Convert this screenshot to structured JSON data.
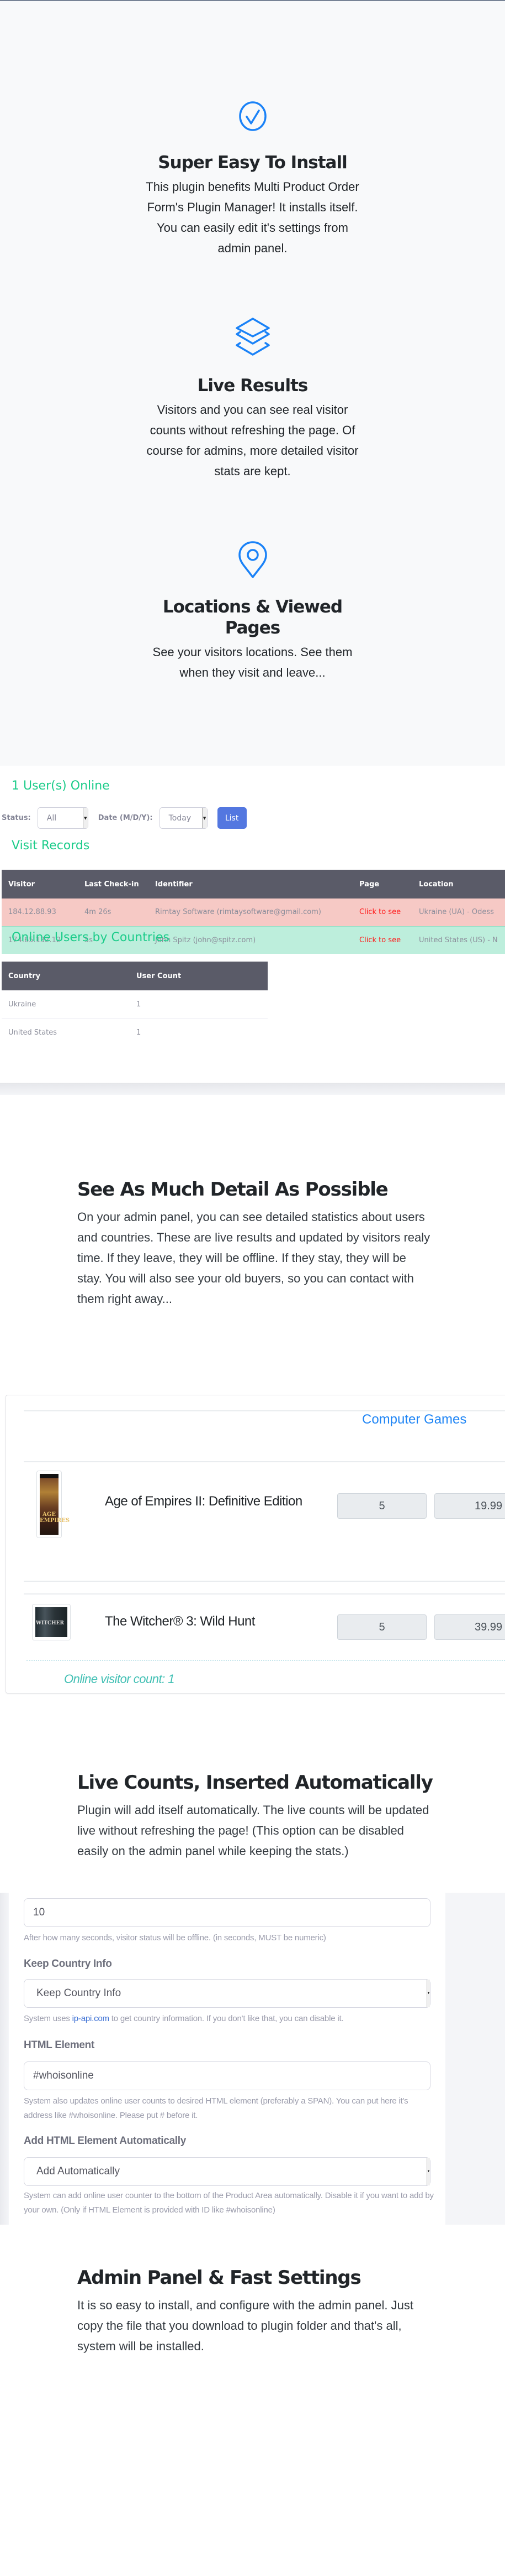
{
  "features": [
    {
      "icon": "check-circle-icon",
      "title": "Super Easy To Install",
      "text": "This plugin benefits Multi Product Order Form's Plugin Manager! It installs itself. You can easily edit it's settings from admin panel."
    },
    {
      "icon": "layers-icon",
      "title": "Live Results",
      "text": "Visitors and you can see real visitor counts without refreshing the page. Of course for admins, more detailed visitor stats are kept."
    },
    {
      "icon": "map-pin-icon",
      "title": "Locations & Viewed Pages",
      "text": "See your visitors locations. See them when they visit and leave..."
    }
  ],
  "visitors_panel": {
    "online_title": "1 User(s) Online",
    "status_label": "Status:",
    "status_value": "All",
    "date_label": "Date (M/D/Y):",
    "date_value": "Today",
    "list_button": "List",
    "records_title": "Visit Records",
    "columns": [
      "Visitor",
      "Last Check-in",
      "Identifier",
      "Page",
      "Location"
    ],
    "rows": [
      {
        "status": "offline",
        "visitor": "184.12.88.93",
        "last_checkin": "4m 26s",
        "identifier": "Rimtay Software (rimtaysoftware@gmail.com)",
        "page": "Click to see",
        "location": "Ukraine (UA) - Odess"
      },
      {
        "status": "online",
        "visitor": "174.65.132.12",
        "last_checkin": "5s",
        "identifier": "John Spitz (john@spitz.com)",
        "page": "Click to see",
        "location": "United States (US) - N"
      }
    ],
    "countries_title": "Online Users by Countries",
    "country_columns": [
      "Country",
      "User Count"
    ],
    "country_rows": [
      {
        "country": "Ukraine",
        "count": "1"
      },
      {
        "country": "United States",
        "count": "1"
      }
    ],
    "colors": {
      "accent_green": "#1ccc8a",
      "offline_row": "#f6c9c5",
      "online_row": "#bdeedc",
      "list_button": "#5377e0"
    }
  },
  "detail_block": {
    "title": "See As Much Detail As Possible",
    "text": "On your admin panel, you can see detailed statistics about users and countries. These are live results and updated by visitors realy time. If they leave, they will be offline. If they stay, they will be stay. You will also see your old buyers, so you can contact with them right away..."
  },
  "product_form": {
    "category": "Computer Games",
    "products": [
      {
        "name": "Age of Empires II: Definitive Edition",
        "quantity": "5",
        "price": "19.99",
        "thumb_text": "AGE EMPIRES"
      },
      {
        "name": "The Witcher® 3: Wild Hunt",
        "quantity": "5",
        "price": "39.99",
        "thumb_text": "WITCHER"
      }
    ],
    "visitor_count_text": "Online visitor count: 1"
  },
  "live_counts_block": {
    "title": "Live Counts, Inserted Automatically",
    "text": "Plugin will add itself automatically. The live counts will be updated live without refreshing the page! (This option can be disabled easily on the admin panel while keeping the stats.)"
  },
  "settings": {
    "timeout_value": "10",
    "timeout_help": "After how many seconds, visitor status will be offline. (in seconds, MUST be numeric)",
    "country_label": "Keep Country Info",
    "country_value": "Keep Country Info",
    "country_help_prefix": "System uses ",
    "country_help_link": "ip-api.com",
    "country_help_suffix": " to get country information. If you don't like that, you can disable it.",
    "html_label": "HTML Element",
    "html_value": "#whoisonline",
    "html_help": "System also updates online user counts to desired HTML element (preferably a SPAN). You can put here it's address like #whoisonline. Please put # before it.",
    "auto_label": "Add HTML Element Automatically",
    "auto_value": "Add Automatically",
    "auto_help": "System can add online user counter to the bottom of the Product Area automatically. Disable it if you want to add by your own. (Only if HTML Element is provided with ID like #whoisonline)"
  },
  "admin_block": {
    "title": "Admin Panel & Fast Settings",
    "text": "It is so easy to install, and configure with the admin panel. Just copy the file that you download to plugin folder and that's all, system will be installed."
  }
}
